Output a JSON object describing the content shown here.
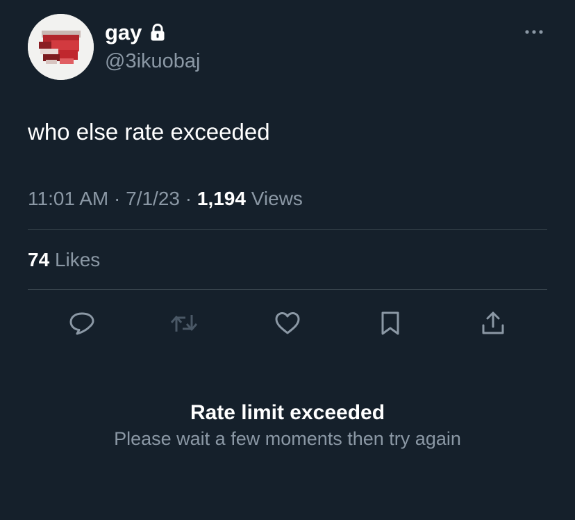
{
  "author": {
    "name": "gay",
    "handle": "@3ikuobaj",
    "protected_icon": "lock-icon",
    "avatar_icon": "avatar-image"
  },
  "tweet": {
    "text": "who else rate exceeded",
    "time": "11:01 AM",
    "separator": "·",
    "date": "7/1/23",
    "views_count": "1,194",
    "views_label": "Views",
    "likes_count": "74",
    "likes_label": "Likes"
  },
  "actions": [
    {
      "icon": "reply-icon"
    },
    {
      "icon": "retweet-icon"
    },
    {
      "icon": "like-icon"
    },
    {
      "icon": "bookmark-icon"
    },
    {
      "icon": "share-icon"
    }
  ],
  "error": {
    "title": "Rate limit exceeded",
    "message": "Please wait a few moments then try again"
  },
  "colors": {
    "background": "#15202b",
    "text_primary": "#ffffff",
    "text_secondary": "#8b98a5",
    "divider": "#38444d",
    "icon": "#8b98a5",
    "icon_disabled": "#4a5866"
  }
}
